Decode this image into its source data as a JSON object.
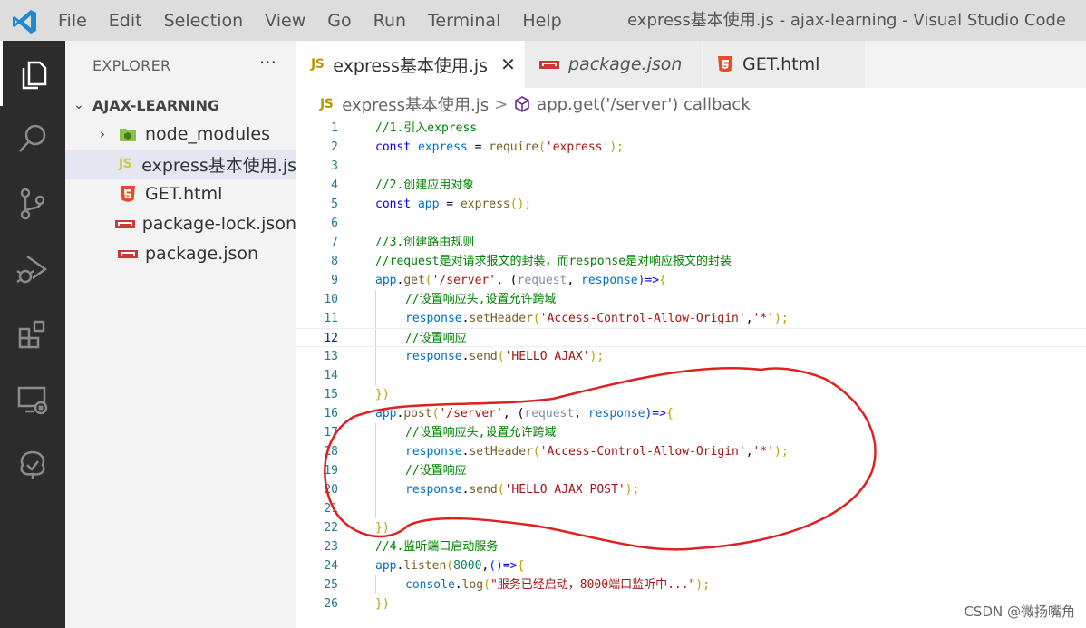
{
  "titlebar": {
    "menu": [
      "File",
      "Edit",
      "Selection",
      "View",
      "Go",
      "Run",
      "Terminal",
      "Help"
    ],
    "window_title": "express基本使用.js - ajax-learning - Visual Studio Code"
  },
  "activity_bar": {
    "items": [
      "explorer-icon",
      "search-icon",
      "source-control-icon",
      "run-debug-icon",
      "extensions-icon",
      "remote-explorer-icon",
      "tree-icon"
    ]
  },
  "sidebar": {
    "header": "EXPLORER",
    "more": "···",
    "folder": "AJAX-LEARNING",
    "items": [
      {
        "name": "node_modules",
        "icon": "node-folder-icon"
      },
      {
        "name": "express基本使用.js",
        "icon": "js-file-icon",
        "selected": true
      },
      {
        "name": "GET.html",
        "icon": "html5-icon"
      },
      {
        "name": "package-lock.json",
        "icon": "npm-icon"
      },
      {
        "name": "package.json",
        "icon": "npm-icon"
      }
    ]
  },
  "tabs": [
    {
      "label": "express基本使用.js",
      "active": true,
      "close": "✕"
    },
    {
      "label": "package.json",
      "italic": true
    },
    {
      "label": "GET.html"
    }
  ],
  "breadcrumb": {
    "file": "express基本使用.js",
    "separator": ">",
    "symbol": "app.get('/server') callback"
  },
  "editor": {
    "current_line": 12,
    "line_numbers": [
      "1",
      "2",
      "3",
      "4",
      "5",
      "6",
      "7",
      "8",
      "9",
      "10",
      "11",
      "12",
      "13",
      "14",
      "15",
      "16",
      "17",
      "18",
      "19",
      "20",
      "21",
      "22",
      "23",
      "24",
      "25",
      "26"
    ]
  },
  "code_text": {
    "l1": "//1.引入express",
    "l2a": "const",
    "l2b": " express ",
    "l2c": "= ",
    "l2d": "require",
    "l2e": "(",
    "l2f": "'express'",
    "l2g": ");",
    "l4": "//2.创建应用对象",
    "l5a": "const",
    "l5b": " app ",
    "l5c": "= ",
    "l5d": "express",
    "l5e": "();",
    "l7": "//3.创建路由规则",
    "l8": "//request是对请求报文的封装，而response是对响应报文的封装",
    "l9a": "app",
    "l9b": ".",
    "l9c": "get",
    "l9d": "(",
    "l9e": "'/server'",
    "l9f": ", (",
    "l9g": "request",
    "l9h": ", ",
    "l9i": "response",
    "l9j": ")",
    "l9k": "=>",
    "l9l": "{",
    "l10": "//设置响应头,设置允许跨域",
    "l11a": "response",
    "l11b": ".",
    "l11c": "setHeader",
    "l11d": "(",
    "l11e": "'Access-Control-Allow-Origin'",
    "l11f": ",",
    "l11g": "'*'",
    "l11h": ");",
    "l12": "//设置响应",
    "l13a": "response",
    "l13b": ".",
    "l13c": "send",
    "l13d": "(",
    "l13e": "'HELLO AJAX'",
    "l13f": ");",
    "l15": "})",
    "l16a": "app",
    "l16b": ".",
    "l16c": "post",
    "l16d": "(",
    "l16e": "'/server'",
    "l16f": ", (",
    "l16g": "request",
    "l16h": ", ",
    "l16i": "response",
    "l16j": ")",
    "l16k": "=>",
    "l16l": "{",
    "l17": "//设置响应头,设置允许跨域",
    "l18a": "response",
    "l18b": ".",
    "l18c": "setHeader",
    "l18d": "(",
    "l18e": "'Access-Control-Allow-Origin'",
    "l18f": ",",
    "l18g": "'*'",
    "l18h": ");",
    "l19": "//设置响应",
    "l20a": "response",
    "l20b": ".",
    "l20c": "send",
    "l20d": "(",
    "l20e": "'HELLO AJAX POST'",
    "l20f": ");",
    "l22": "})",
    "l23": "//4.监听端口启动服务",
    "l24a": "app",
    "l24b": ".",
    "l24c": "listen",
    "l24d": "(",
    "l24e": "8000",
    "l24f": ",",
    "l24g": "()",
    "l24h": "=>",
    "l24i": "{",
    "l25a": "console",
    "l25b": ".",
    "l25c": "log",
    "l25d": "(",
    "l25e": "\"服务已经启动，8000端口监听中...\"",
    "l25f": ");",
    "l26": "})"
  },
  "watermark": "CSDN @微扬嘴角",
  "colors": {
    "activity_bar": "#2c2c2c",
    "sidebar": "#f3f3f3",
    "titlebar": "#dddddd",
    "comment": "#008000",
    "keyword": "#0000ff",
    "string": "#a31515",
    "annotation_circle": "#e02020"
  }
}
